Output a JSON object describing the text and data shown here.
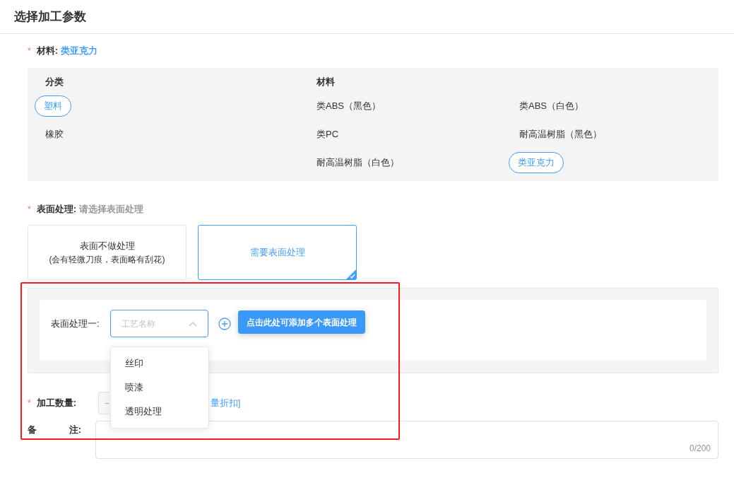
{
  "title": "选择加工参数",
  "material": {
    "label": "材料:",
    "required_mark": "*",
    "value": "类亚克力",
    "columns": [
      "分类",
      "材料"
    ],
    "categories": [
      {
        "label": "塑料",
        "selected": true
      },
      {
        "label": "橡胶",
        "selected": false
      }
    ],
    "materials": [
      {
        "label": "类ABS（黑色）",
        "selected": false
      },
      {
        "label": "类ABS（白色）",
        "selected": false
      },
      {
        "label": "类PC",
        "selected": false
      },
      {
        "label": "耐高温树脂（黑色）",
        "selected": false
      },
      {
        "label": "耐高温树脂（白色）",
        "selected": false
      },
      {
        "label": "类亚克力",
        "selected": true
      }
    ]
  },
  "surface": {
    "label": "表面处理:",
    "required_mark": "*",
    "hint": "请选择表面处理",
    "options": [
      {
        "title": "表面不做处理",
        "subtitle": "(会有轻微刀痕，表面略有刮花)",
        "selected": false
      },
      {
        "title": "需要表面处理",
        "selected": true
      }
    ],
    "process": {
      "label": "表面处理一:",
      "placeholder": "工艺名称",
      "expanded": true,
      "tooltip": "点击此处可添加多个表面处理",
      "options": [
        "丝印",
        "喷漆",
        "透明处理"
      ]
    }
  },
  "quantity": {
    "label": "加工数量:",
    "required_mark": "*",
    "stepper": "−",
    "link": "量折扣]"
  },
  "remarks": {
    "label_start": "备",
    "label_end": "注:",
    "counter": "0/200"
  }
}
